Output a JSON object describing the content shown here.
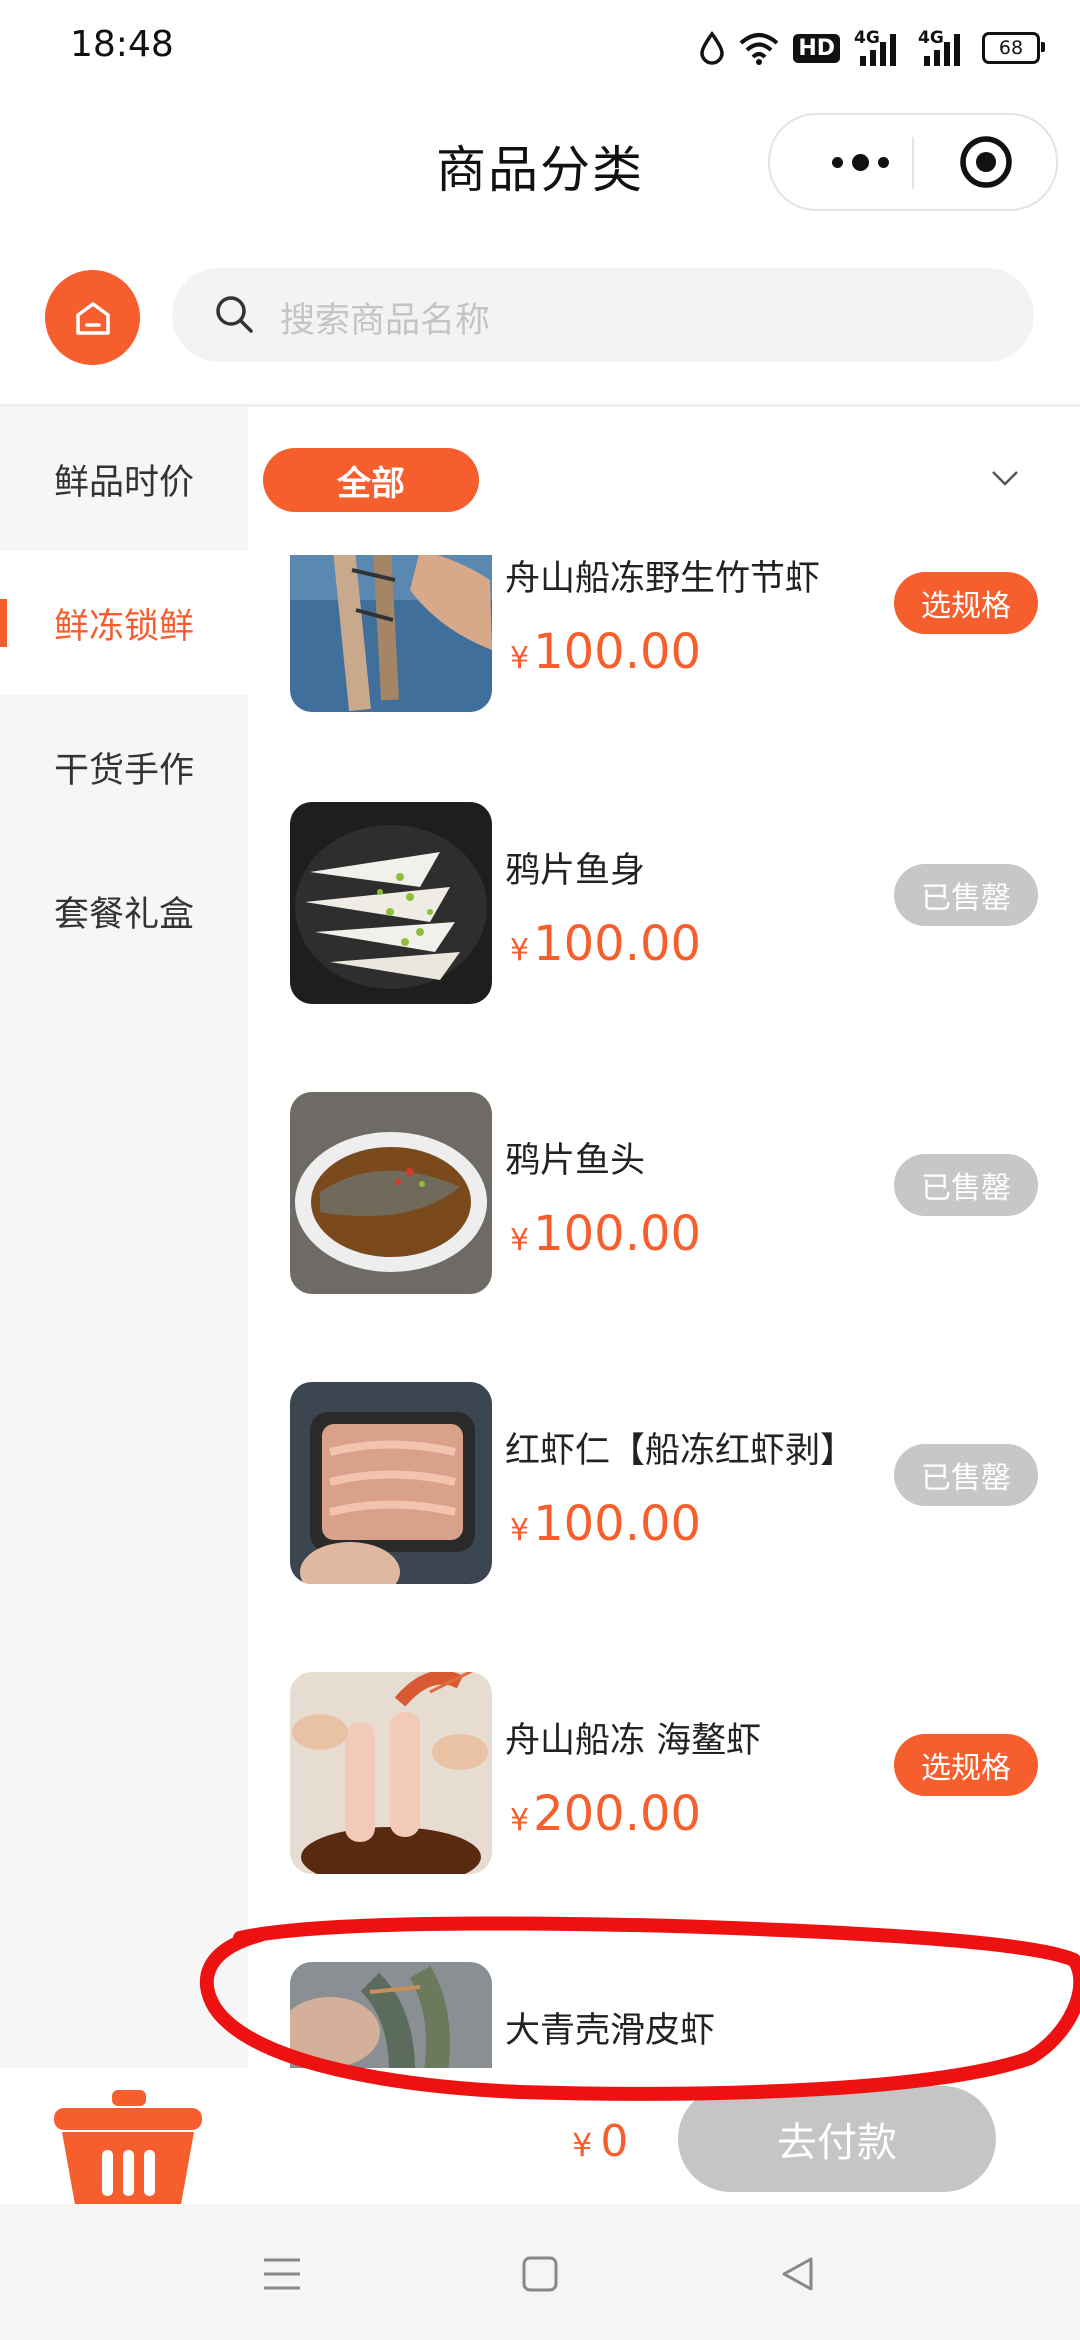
{
  "status_bar": {
    "time": "18:48",
    "hd": "HD",
    "net1": "4G",
    "net2": "4G",
    "battery": "68"
  },
  "header": {
    "title": "商品分类"
  },
  "search": {
    "placeholder": "搜索商品名称"
  },
  "sidebar": {
    "items": [
      {
        "label": "鲜品时价",
        "active": false
      },
      {
        "label": "鲜冻锁鲜",
        "active": true
      },
      {
        "label": "干货手作",
        "active": false
      },
      {
        "label": "套餐礼盒",
        "active": false
      }
    ]
  },
  "filter": {
    "chip_label": "全部"
  },
  "products": [
    {
      "name": "舟山船冻野生竹节虾",
      "currency": "¥",
      "price": "100.00",
      "button": "选规格",
      "available": true
    },
    {
      "name": "鸦片鱼身",
      "currency": "¥",
      "price": "100.00",
      "button": "已售罄",
      "available": false
    },
    {
      "name": "鸦片鱼头",
      "currency": "¥",
      "price": "100.00",
      "button": "已售罄",
      "available": false
    },
    {
      "name": "红虾仁【船冻红虾剥】",
      "currency": "¥",
      "price": "100.00",
      "button": "已售罄",
      "available": false
    },
    {
      "name": "舟山船冻 海鳌虾",
      "currency": "¥",
      "price": "200.00",
      "button": "选规格",
      "available": true
    },
    {
      "name": "大青壳滑皮虾",
      "currency": "¥",
      "price": "",
      "button": "",
      "available": true
    }
  ],
  "cart_bar": {
    "currency": "¥",
    "total": "0",
    "pay_label": "去付款"
  },
  "colors": {
    "accent": "#f65e2e",
    "disabled": "#c7c7c7",
    "annotation": "#ee1111"
  }
}
